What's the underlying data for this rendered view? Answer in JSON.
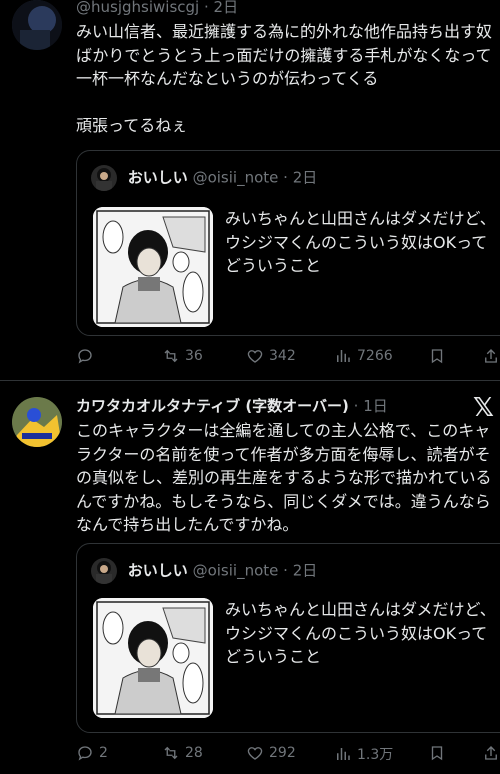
{
  "post1": {
    "handle": "@husjghsiwiscgj",
    "dot": "·",
    "time": "2日",
    "text": "みい山信者、最近擁護する為に的外れな他作品持ち出す奴ばかりでとうとう上っ面だけの擁護する手札がなくなって一杯一杯なんだなというのが伝わってくる\n\n頑張ってるねぇ",
    "quote": {
      "name": "おいしい",
      "handle": "@oisii_note",
      "dot": "·",
      "time": "2日",
      "text": "みいちゃんと山田さんはダメだけど、ウシジマくんのこういう奴はOKってどういうこと"
    },
    "actions": {
      "replies": "",
      "reposts": "36",
      "likes": "342",
      "views": "7266"
    }
  },
  "post2": {
    "name": "カワタカオルタナティブ (字数オーバー)",
    "dot": "·",
    "time": "1日",
    "text": "このキャラクターは全編を通しての主人公格で、このキャラクターの名前を使って作者が多方面を侮辱し、読者がその真似をし、差別の再生産をするような形で描かれているんですかね。もしそうなら、同じくダメでは。違うんならなんで持ち出したんですかね。",
    "quote": {
      "name": "おいしい",
      "handle": "@oisii_note",
      "dot": "·",
      "time": "2日",
      "text": "みいちゃんと山田さんはダメだけど、ウシジマくんのこういう奴はOKってどういうこと"
    },
    "actions": {
      "replies": "2",
      "reposts": "28",
      "likes": "292",
      "views": "1.3万"
    }
  },
  "icons": [
    "x-logo-icon",
    "reply-icon",
    "repost-icon",
    "like-icon",
    "views-icon",
    "bookmark-icon",
    "share-icon"
  ],
  "colors": {
    "background": "#000000",
    "text": "#e7e9ea",
    "muted": "#71767b",
    "border": "#2f3336"
  }
}
